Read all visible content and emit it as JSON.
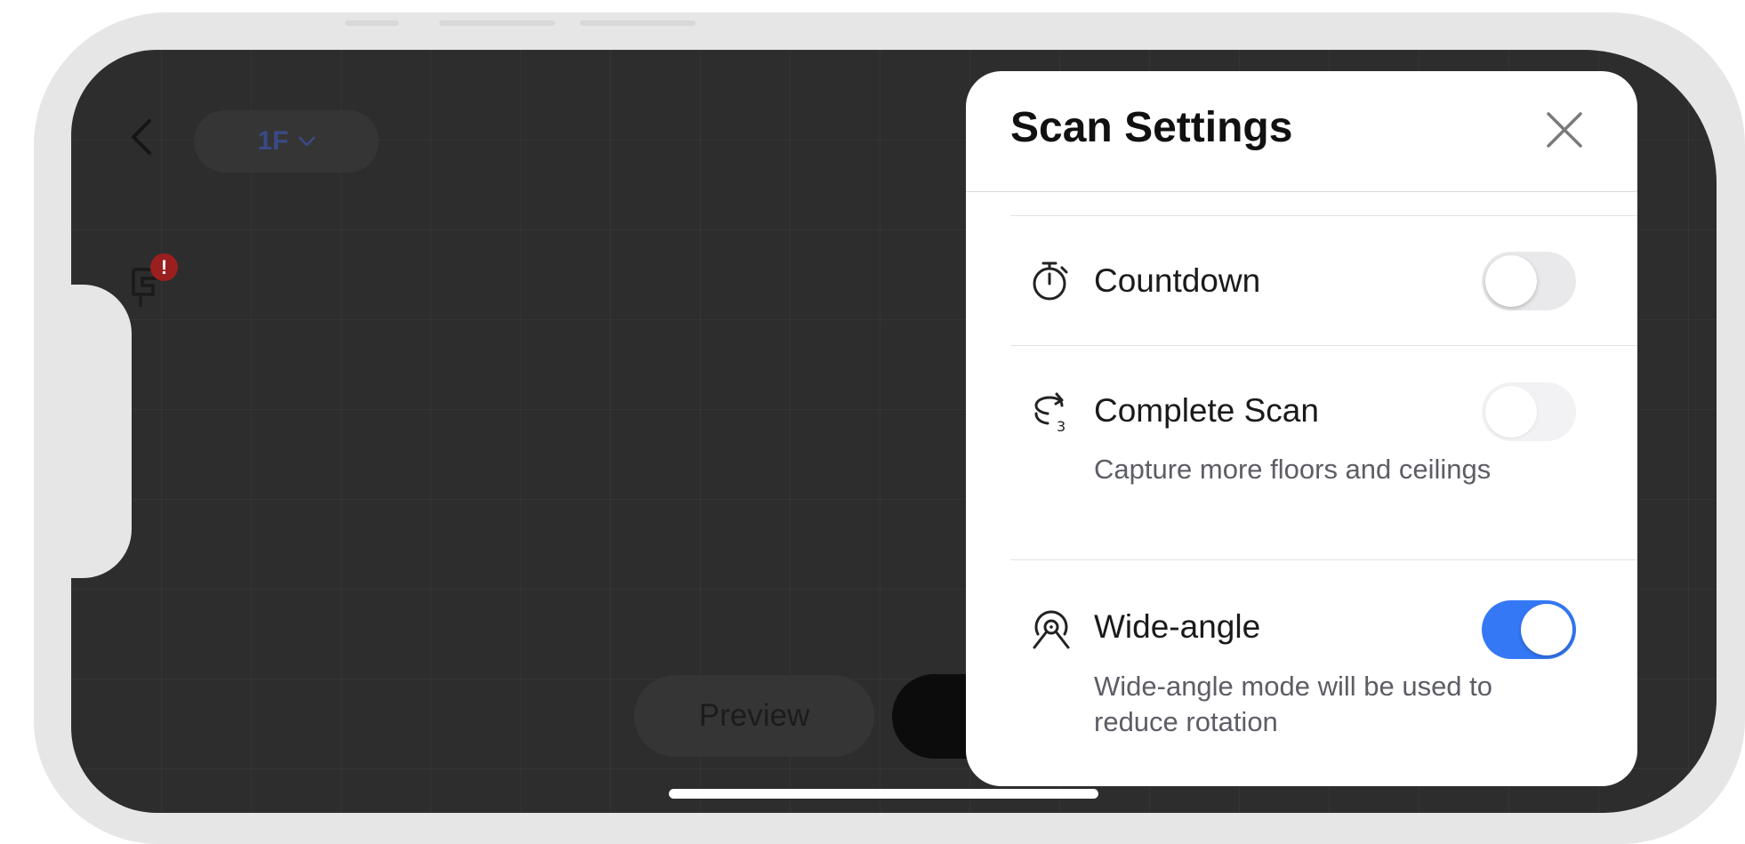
{
  "toolbar": {
    "floor_label": "1F"
  },
  "alert": {
    "badge_text": "!"
  },
  "bottom_bar": {
    "preview_label": "Preview"
  },
  "settings_sheet": {
    "title": "Scan Settings",
    "items": [
      {
        "title": "Countdown",
        "description": "",
        "icon": "stopwatch-icon",
        "enabled": false
      },
      {
        "title": "Complete Scan",
        "description": "Capture more floors and ceilings",
        "icon": "rotate-3-icon",
        "enabled": false
      },
      {
        "title": "Wide-angle",
        "description": "Wide-angle mode will be used to reduce rotation",
        "icon": "wide-angle-icon",
        "enabled": true
      }
    ]
  },
  "colors": {
    "toggle_on": "#3478f6",
    "alert": "#9b1f1f",
    "canvas": "#2d2d2d",
    "floor_label": "#3a4a86"
  }
}
